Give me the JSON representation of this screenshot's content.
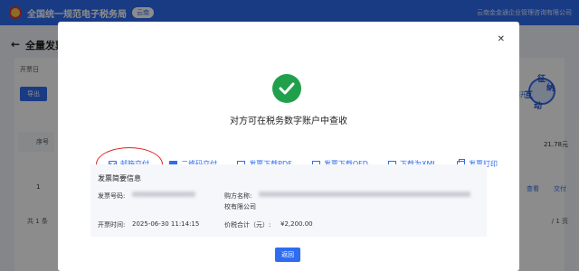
{
  "header": {
    "app_title": "全国统一规范电子税务局",
    "region": "云南",
    "company": "云南金金通企业管理咨询有限公司"
  },
  "background": {
    "back_icon": "arrow-left-icon",
    "page_title": "全量发票",
    "filter_label": "开票日",
    "export_label": "导出",
    "more_label": "展开",
    "col_seq": "序号",
    "row_seq": "1",
    "amount": "21.78元",
    "link_view": "查看",
    "link_deliver": "交付",
    "total": "共 1 条",
    "pager": "/ 1 页"
  },
  "assistant": {
    "chars": [
      "征",
      "纳",
      "互",
      "动"
    ]
  },
  "modal": {
    "close_icon": "close-icon",
    "success_icon": "check-circle-icon",
    "message": "对方可在税务数字账户中查收",
    "actions": [
      {
        "label": "邮箱交付",
        "icon": "mail-icon"
      },
      {
        "label": "二维码交付",
        "icon": "qrcode-icon"
      },
      {
        "label": "发票下载PDF",
        "icon": "document-icon"
      },
      {
        "label": "发票下载OFD",
        "icon": "document-icon"
      },
      {
        "label": "下载为XML",
        "icon": "document-icon"
      },
      {
        "label": "发票打印",
        "icon": "printer-icon"
      }
    ],
    "info": {
      "title": "发票简要信息",
      "invoice_no_label": "发票号码:",
      "buyer_label": "购方名称:",
      "buyer_tail": "校有限公司",
      "date_label": "开票时间:",
      "date_value": "2025-06-30 11:14:15",
      "total_label": "价税合计（元）:",
      "total_value": "¥2,200.00"
    },
    "return_label": "返回"
  },
  "colors": {
    "primary": "#2f6cf0",
    "success": "#21a04b",
    "annotation": "#e02020"
  }
}
